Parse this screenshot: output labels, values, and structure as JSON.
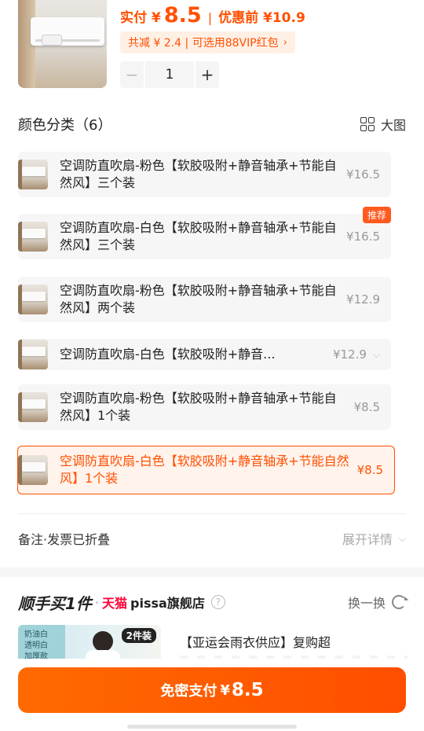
{
  "header": {
    "pay_label": "实付",
    "currency": "¥",
    "pay_amount": "8.5",
    "separator": "|",
    "original_label": "优惠前 ¥10.9",
    "discount_text": "共减 ¥ 2.4 | 可选用88VIP红包",
    "discount_chevron": "›",
    "quantity": "1",
    "minus_label": "−",
    "plus_label": "+"
  },
  "options_section": {
    "title": "颜色分类（6）",
    "view_label": "大图"
  },
  "options": [
    {
      "name": "空调防直吹扇-粉色【软胶吸附+静音轴承+节能自然风】三个装",
      "price": "¥16.5"
    },
    {
      "name": "空调防直吹扇-白色【软胶吸附+静音轴承+节能自然风】三个装",
      "price": "¥16.5",
      "tag": "推荐"
    },
    {
      "name": "空调防直吹扇-粉色【软胶吸附+静音轴承+节能自然风】两个装",
      "price": "¥12.9"
    },
    {
      "name": "空调防直吹扇-白色【软胶吸附+静音...",
      "price": "¥12.9",
      "chevron": "⌵"
    },
    {
      "name": "空调防直吹扇-粉色【软胶吸附+静音轴承+节能自然风】1个装",
      "price": "¥8.5"
    },
    {
      "name": "空调防直吹扇-白色【软胶吸附+静音轴承+节能自然风】1个装",
      "price": "¥8.5",
      "selected": true
    }
  ],
  "note_row": {
    "label": "备注·发票已折叠",
    "expand_label": "展开详情",
    "chevron": "⌵"
  },
  "recommendation": {
    "brand": "顺手买1件",
    "dot": "·",
    "platform": "天猫",
    "store": "pissa旗舰店",
    "help": "?",
    "refresh_label": "换一换",
    "thumb_side_text": "奶油白\n透明白\n加厚款",
    "thumb_badge": "2件装",
    "item_title": "【亚运会雨衣供应】复购超"
  },
  "pay_button": {
    "label": "免密支付",
    "currency": "¥",
    "amount": "8.5"
  },
  "colors": {
    "accent": "#ff5000",
    "selected_bg": "#fff3ec",
    "option_bg": "#f6f6f6",
    "tmall_red": "#ff0036"
  }
}
